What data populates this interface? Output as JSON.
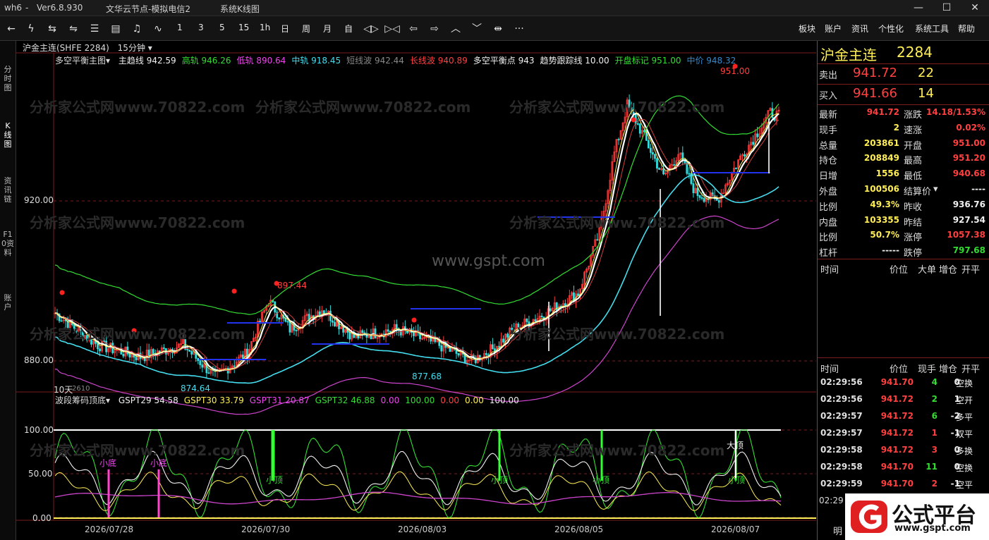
{
  "titlebar": {
    "app": "wh6",
    "dash": "-",
    "version": "Ver6.8.930",
    "server": "文华云节点-模拟电信2",
    "mode": "系统K线图"
  },
  "toolbar": {
    "periods": [
      "1",
      "3",
      "5",
      "15",
      "1h",
      "日",
      "周",
      "月",
      "自"
    ],
    "right_menu": [
      "板块",
      "账户",
      "资讯",
      "个性化",
      "系统工具",
      "帮助"
    ]
  },
  "left_tabs": [
    "分时图",
    "K线图",
    "资讯链",
    "F10资料",
    "账户"
  ],
  "symbol_bar": {
    "symbol": "沪金主连(SHFE 2284)",
    "period": "15分钟"
  },
  "main_header": {
    "indicator": "多空平衡主图",
    "items": [
      {
        "text": "主趋线 942.59",
        "color": "#f0f0f0"
      },
      {
        "text": "高轨 946.26",
        "color": "#33dd33"
      },
      {
        "text": "低轨 890.64",
        "color": "#ee44ee"
      },
      {
        "text": "中轨 918.45",
        "color": "#44ddee"
      },
      {
        "text": "短线波 942.44",
        "color": "#888888"
      },
      {
        "text": "长线波 940.89",
        "color": "#ff4040"
      },
      {
        "text": "多空平衡点 943",
        "color": "#f0f0f0"
      },
      {
        "text": "趋势跟踪线 10.00",
        "color": "#f0f0f0"
      },
      {
        "text": "开盘标记 951.00",
        "color": "#33dd33"
      },
      {
        "text": "中价 948.32",
        "color": "#3388cc"
      }
    ]
  },
  "main_axis": {
    "y_labels": [
      "920.00",
      "880.00"
    ],
    "ylim": [
      870,
      960
    ]
  },
  "price_annotations": {
    "top_high": "951.00",
    "mid_high": "897.44",
    "low1": "874.64",
    "low2": "877.68",
    "bars_label": "10天",
    "code_label": "2610"
  },
  "watermark": {
    "text": "分析家公式网www.70822.com",
    "center": "www.gspt.com"
  },
  "sub_header": {
    "indicator": "波段筹码顶底",
    "items": [
      {
        "text": "GSPT29 54.58",
        "color": "#f0f0f0"
      },
      {
        "text": "GSPT30 33.79",
        "color": "#ffee55"
      },
      {
        "text": "GSPT31 20.87",
        "color": "#ee44ee"
      },
      {
        "text": "GSPT32 46.88",
        "color": "#33dd33"
      },
      {
        "text": "0.00",
        "color": "#ee44ee"
      },
      {
        "text": "100.00",
        "color": "#33dd33"
      },
      {
        "text": "0.00",
        "color": "#ff4040"
      },
      {
        "text": "0.00",
        "color": "#ffee55"
      },
      {
        "text": "100.00",
        "color": "#f0f0f0"
      }
    ]
  },
  "sub_axis": {
    "y_labels": [
      "100.00",
      "50.00",
      "0.00"
    ]
  },
  "sub_annotations": {
    "small_bottom": "小底",
    "small_top": "小顶",
    "big_top": "大顶"
  },
  "x_axis": {
    "labels": [
      "2026/07/28",
      "2026/07/30",
      "2026/08/03",
      "2026/08/05",
      "2026/08/07"
    ]
  },
  "quote": {
    "name": "沪金主连",
    "code": "2284",
    "ask_label": "卖出",
    "ask_price": "941.72",
    "ask_vol": "22",
    "bid_label": "买入",
    "bid_price": "941.66",
    "bid_vol": "14",
    "rows": [
      {
        "l1": "最新",
        "v1": "941.72",
        "c1": "red",
        "l2": "涨跌",
        "v2": "14.18/1.53%",
        "c2": "red"
      },
      {
        "l1": "现手",
        "v1": "2",
        "c1": "yel",
        "l2": "速涨",
        "v2": "0.02%",
        "c2": "red"
      },
      {
        "l1": "总量",
        "v1": "203861",
        "c1": "yel",
        "l2": "开盘",
        "v2": "951.00",
        "c2": "red"
      },
      {
        "l1": "持仓",
        "v1": "208849",
        "c1": "yel",
        "l2": "最高",
        "v2": "951.20",
        "c2": "red"
      },
      {
        "l1": "日增",
        "v1": "1556",
        "c1": "yel",
        "l2": "最低",
        "v2": "940.68",
        "c2": "red"
      },
      {
        "l1": "外盘",
        "v1": "100506",
        "c1": "yel",
        "l2": "结算价",
        "v2": "----",
        "c2": "wht"
      },
      {
        "l1": "比例",
        "v1": "49.3%",
        "c1": "yel",
        "l2": "昨收",
        "v2": "936.76",
        "c2": "wht"
      },
      {
        "l1": "内盘",
        "v1": "103355",
        "c1": "yel",
        "l2": "昨结",
        "v2": "927.54",
        "c2": "wht"
      },
      {
        "l1": "比例",
        "v1": "50.7%",
        "c1": "yel",
        "l2": "涨停",
        "v2": "1057.38",
        "c2": "red"
      },
      {
        "l1": "杠杆",
        "v1": "-----",
        "c1": "wht",
        "l2": "跌停",
        "v2": "797.68",
        "c2": "grn"
      }
    ],
    "big_order_headers": [
      "时间",
      "价位",
      "大单",
      "增仓",
      "开平"
    ],
    "tick_headers": [
      "时间",
      "价位",
      "现手",
      "增仓",
      "开平"
    ],
    "ticks": [
      {
        "time": "02:29:56",
        "price": "941.70",
        "vol": "4",
        "oi": "0",
        "type": "空换",
        "vc": "grn"
      },
      {
        "time": "02:29:56",
        "price": "941.72",
        "vol": "2",
        "oi": "1",
        "type": "空开",
        "vc": "grn"
      },
      {
        "time": "02:29:57",
        "price": "941.72",
        "vol": "6",
        "oi": "-2",
        "type": "多平",
        "vc": "grn"
      },
      {
        "time": "02:29:57",
        "price": "941.72",
        "vol": "1",
        "oi": "-1",
        "type": "双平",
        "vc": "red"
      },
      {
        "time": "02:29:58",
        "price": "941.72",
        "vol": "3",
        "oi": "0",
        "type": "多换",
        "vc": "red"
      },
      {
        "time": "02:29:58",
        "price": "941.70",
        "vol": "11",
        "oi": "0",
        "type": "空换",
        "vc": "grn"
      },
      {
        "time": "02:29:59",
        "price": "941.70",
        "vol": "2",
        "oi": "-1",
        "type": "空平",
        "vc": "red"
      }
    ],
    "partial_time": "02:29",
    "tab_hint": "明"
  },
  "logo": {
    "name": "公式平台",
    "url_text": "www.gspt.com",
    "color": "#e02020"
  }
}
